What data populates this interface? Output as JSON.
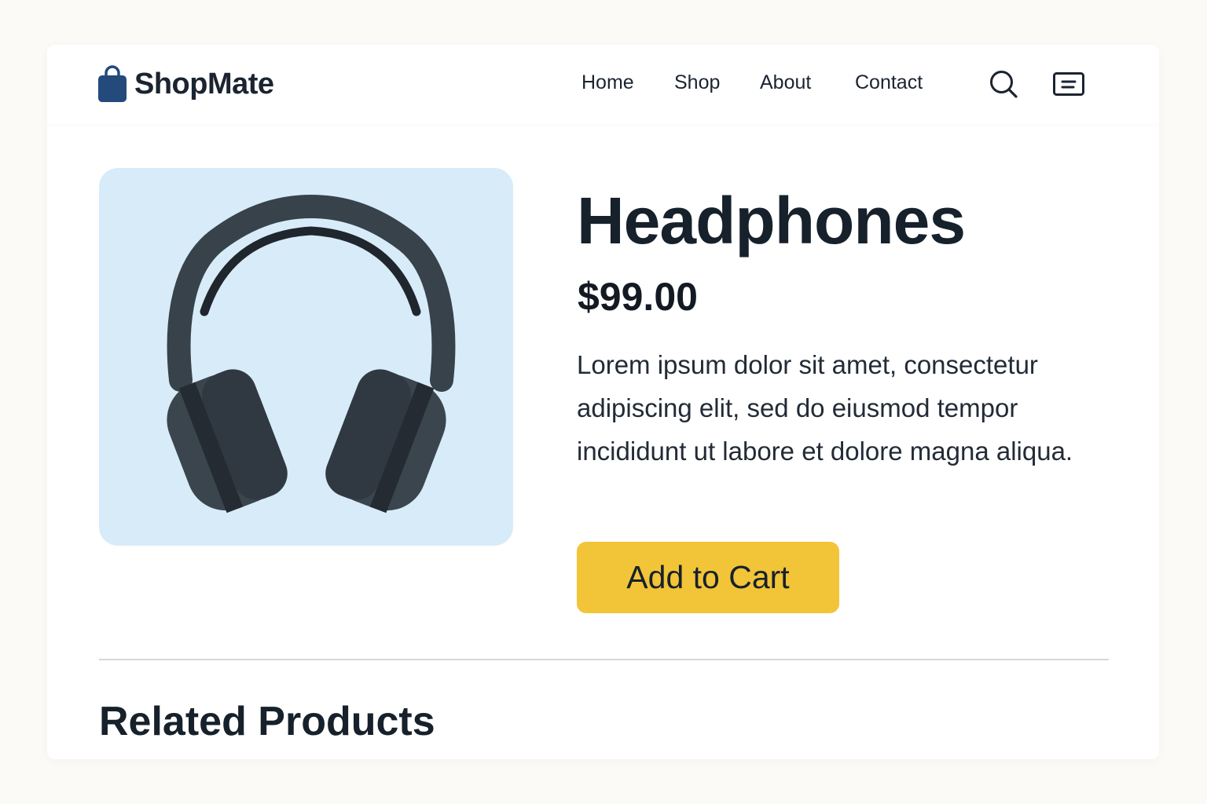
{
  "header": {
    "brand": {
      "name": "ShopMate",
      "icon": "shopping-bag-icon",
      "icon_color": "#244a7c"
    },
    "nav": [
      {
        "label": "Home"
      },
      {
        "label": "Shop"
      },
      {
        "label": "About"
      },
      {
        "label": "Contact"
      }
    ],
    "icons": [
      "search-icon",
      "menu-icon"
    ]
  },
  "product": {
    "title": "Headphones",
    "price": "$99.00",
    "description": "Lorem ipsum dolor sit amet, consectetur adipiscing elit, sed do eiusmod tempor incididunt ut labore et dolore magna aliqua.",
    "image_icon": "headphones-icon",
    "image_background": "#d8ebf9",
    "add_to_cart_label": "Add to Cart",
    "add_to_cart_color": "#f2c438"
  },
  "related": {
    "title": "Related Products"
  }
}
